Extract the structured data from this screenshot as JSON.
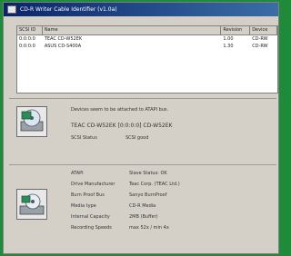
{
  "window": {
    "title": "CD-R Writer Cable Identifier (v1.0a)"
  },
  "device_list": {
    "columns": [
      "SCSI ID",
      "Name",
      "Revision",
      "Device"
    ],
    "rows": [
      [
        "0:0:0:0",
        "TEAC   CD-W52EK",
        "1.00",
        "CD-RW"
      ],
      [
        "0:0:0:0",
        "ASUS   CD-S400A",
        "1.30",
        "CD-RW"
      ]
    ]
  },
  "section1": {
    "caption": "Devices seem to be attached to ATAPI bus.",
    "device_line": "TEAC CD-W52EK  [0:0:0:0] CD-W52EK",
    "status_label": "SCSI Status",
    "status_value": "SCSI good"
  },
  "section2": {
    "fields": [
      {
        "label": "ATAPI",
        "value": "Slave Status: OK"
      },
      {
        "label": "Drive Manufacturer",
        "value": "Teac Corp. (TEAC Ltd.)"
      },
      {
        "label": "Burn Proof Bus",
        "value": "Sanyo BurnProof"
      },
      {
        "label": "Media type",
        "value": "CD-R Media"
      },
      {
        "label": "Internal Capacity",
        "value": "2MB (Buffer)"
      },
      {
        "label": "Recording Speeds",
        "value": "max 52x / min 4x"
      }
    ]
  }
}
